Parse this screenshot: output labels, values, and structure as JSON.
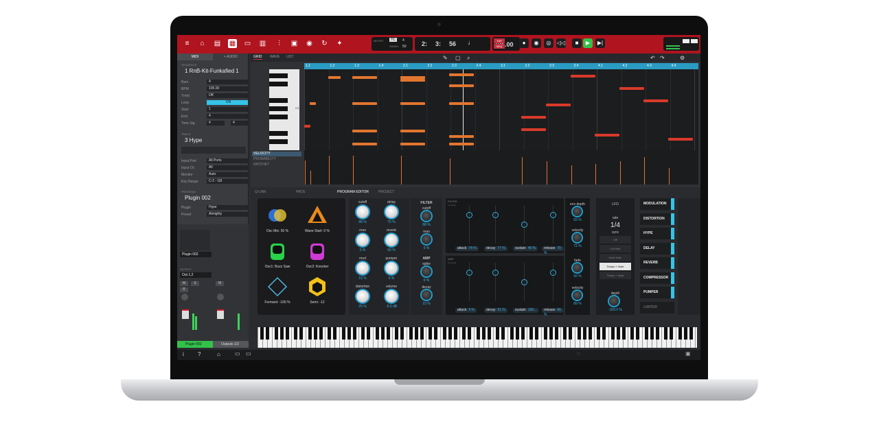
{
  "toolbar": {
    "tc": "TC",
    "tc_val": "4",
    "swing": "50",
    "swing_label": "SWING",
    "metro_label": "METRO",
    "bars": "2:",
    "beat": "3:",
    "tick": "56",
    "bpm": "105.00",
    "tap": "TAP",
    "seq": "SEQ"
  },
  "left": {
    "tab_midi": "MIDI",
    "tab_audio": "+ AUDIO",
    "seq_section": "SEQUENCE",
    "sequence": "1 RnB-Kit-Funkafied 1",
    "fields": [
      {
        "label": "Bars",
        "value": "4"
      },
      {
        "label": "BPM",
        "value": "105.00"
      },
      {
        "label": "Tmrtc",
        "value": "Off"
      },
      {
        "label": "Loop",
        "value": "ON"
      },
      {
        "label": "Start",
        "value": "1"
      },
      {
        "label": "End",
        "value": "4"
      },
      {
        "label": "Time Sig",
        "value": "4",
        "value2": "4"
      }
    ],
    "track_section": "TRACK",
    "track": "3 Hype",
    "ports": [
      {
        "label": "Input Port",
        "value": "All Ports"
      },
      {
        "label": "Input Ch",
        "value": "All"
      },
      {
        "label": "Monitor",
        "value": "Auto"
      },
      {
        "label": "Key Range",
        "value": "C-2 - G8"
      }
    ],
    "program_section": "PROGRAM",
    "program": "Plugin 002",
    "plugin_label": "Plugin",
    "plugin_value": "Hype",
    "preset_label": "Preset",
    "preset_value": "Almighty"
  },
  "mixer": {
    "channel": "Plugin 002",
    "output_label": "OUTPUT",
    "output": "Out 1,2",
    "m": "M",
    "s": "S",
    "r": "R",
    "tab1": "Plugin 002",
    "tab2": "Outputs 1/2"
  },
  "grid": {
    "tabs": [
      "GRID",
      "WAVE",
      "LIST"
    ],
    "ruler": [
      "1.1",
      "1.2",
      "1.3",
      "1.4",
      "2.1",
      "2.2",
      "2.3",
      "2.4",
      "3.1",
      "3.2",
      "3.3",
      "3.4",
      "4.1",
      "4.2",
      "4.3",
      "4.4"
    ],
    "lanes": [
      "VELOCITY",
      "PROBABILITY",
      "RATCHET"
    ],
    "c3": "C3"
  },
  "bottom": {
    "tabs": [
      "Q-LINK",
      "PADS",
      "PROGRAM EDITOR",
      "PROJECT"
    ],
    "shapes": [
      {
        "label": "Osc Mix: 50 %"
      },
      {
        "label": "Wave Start: 0 %"
      },
      {
        "label": "Osc1: Buzz Saw"
      },
      {
        "label": "Osc2: Knocker"
      },
      {
        "label": "Formant: -100 %"
      },
      {
        "label": "Semi: -12"
      }
    ],
    "knobs1": [
      {
        "label": "cutoff",
        "value": "88 %"
      },
      {
        "label": "delay",
        "value": "75 %"
      },
      {
        "label": "reso",
        "value": "0 %"
      },
      {
        "label": "reverb",
        "value": "60 %"
      },
      {
        "label": "mod",
        "value": "15 %"
      },
      {
        "label": "pumper",
        "value": "0 %"
      },
      {
        "label": "distortion",
        "value": "25 %"
      },
      {
        "label": "volume",
        "value": "-5.0 dB"
      }
    ],
    "filter_title": "FILTER",
    "filter_knobs": [
      {
        "label": "cutoff",
        "value": "88 %"
      },
      {
        "label": "reso",
        "value": "0 %"
      }
    ],
    "amp_title": "AMP",
    "amp_knobs": [
      {
        "label": "spike",
        "value": "0 %"
      },
      {
        "label": "decay",
        "value": "15 %"
      }
    ],
    "env_filter_title": "FILTER",
    "env_amp_title": "AMP",
    "env_sub": "envelope",
    "env1": [
      {
        "label": "attack",
        "value": "74 %"
      },
      {
        "label": "decay",
        "value": "77 %"
      },
      {
        "label": "sustain",
        "value": "40 %"
      },
      {
        "label": "release",
        "value": "70 %"
      }
    ],
    "env2": [
      {
        "label": "attack",
        "value": "4 %"
      },
      {
        "label": "decay",
        "value": "51 %"
      },
      {
        "label": "sustain",
        "value": "100..."
      },
      {
        "label": "release",
        "value": "66 %"
      }
    ],
    "env_knobs": [
      {
        "label": "env depth",
        "value": "65 %"
      },
      {
        "label": "velocity",
        "value": "72 %"
      },
      {
        "label": "fade",
        "value": "50 %"
      },
      {
        "label": "velocity",
        "value": "89 %"
      }
    ],
    "lfo": {
      "title": "LFO",
      "rate_label": "rate",
      "rate": "1/4",
      "sync_label": "sync",
      "opts": [
        "Off",
        "1st Note",
        "Each Note",
        "Tempo + Note",
        "Tempo + Beat"
      ],
      "depth_label": "depth",
      "depth": "-100.0 %"
    },
    "fx": [
      "MODULATION",
      "DISTORTION",
      "HYPE",
      "DELAY",
      "REVERB",
      "COMPRESSOR",
      "PUMPER",
      "LIMITER"
    ]
  },
  "colors": {
    "accent": "#b0141f",
    "cyan": "#2a9bc2",
    "note_orange": "#e2762f",
    "note_red": "#d93a2a"
  }
}
